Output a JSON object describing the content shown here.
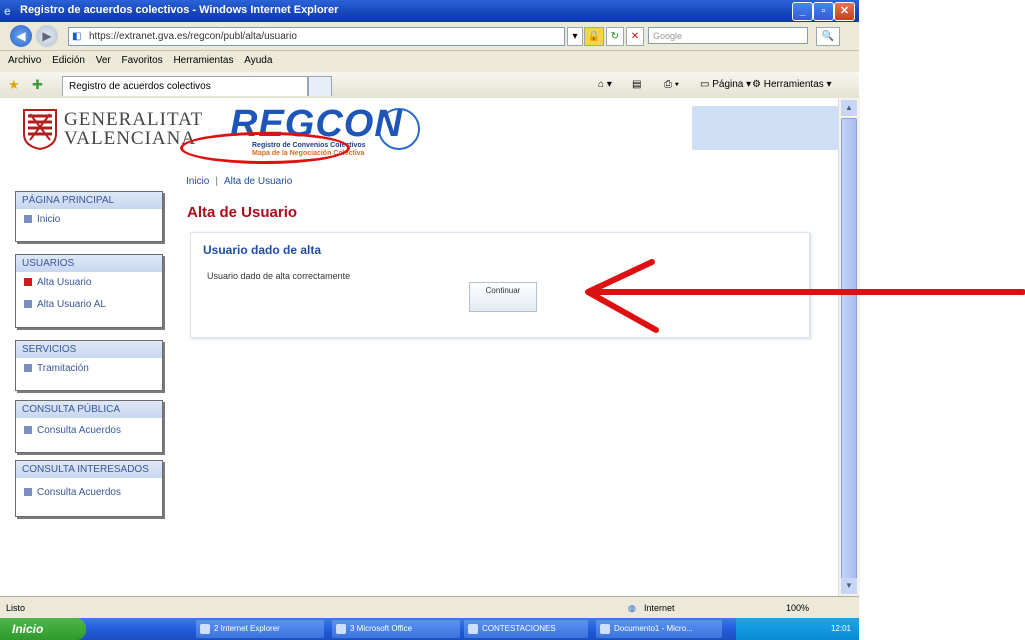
{
  "window": {
    "title": "Registro de acuerdos colectivos - Windows Internet Explorer"
  },
  "address_bar": {
    "url": "https://extranet.gva.es/regcon/publ/alta/usuario",
    "search_placeholder": "Google"
  },
  "menu": [
    "Archivo",
    "Edición",
    "Ver",
    "Favoritos",
    "Herramientas",
    "Ayuda"
  ],
  "favorites_bar": {
    "tab_title": "Registro de acuerdos colectivos",
    "page_label": "Página",
    "tools_label": "Herramientas"
  },
  "header": {
    "gv_line1": "GENERALITAT",
    "gv_line2": "VALENCIANA",
    "regcon": "REGCON",
    "regcon_sub1": "Registro de Convenios Colectivos",
    "regcon_sub2": "Mapa de la Negociación Colectiva"
  },
  "breadcrumb": {
    "home": "Inicio",
    "separator": "|",
    "current": "Alta de Usuario"
  },
  "page_title": "Alta de Usuario",
  "sidebar": [
    {
      "header": "PÁGINA PRINCIPAL",
      "items": [
        {
          "label": "Inicio",
          "active": false
        }
      ]
    },
    {
      "header": "USUARIOS",
      "items": [
        {
          "label": "Alta Usuario",
          "active": true
        },
        {
          "label": "Alta Usuario AL",
          "active": false
        }
      ]
    },
    {
      "header": "SERVICIOS",
      "items": [
        {
          "label": "Tramitación",
          "active": false
        }
      ]
    },
    {
      "header": "CONSULTA PÚBLICA",
      "items": [
        {
          "label": "Consulta Acuerdos",
          "active": false
        }
      ]
    },
    {
      "header": "CONSULTA INTERESADOS",
      "items": [
        {
          "label": "Consulta Acuerdos",
          "active": false
        }
      ]
    }
  ],
  "panel": {
    "heading": "Usuario dado de alta",
    "message": "Usuario dado de alta correctamente",
    "button_label": "Continuar"
  },
  "status_bar": {
    "left": "Listo",
    "zone": "Internet",
    "zoom": "100%"
  },
  "taskbar": {
    "start_label": "Inicio",
    "buttons": [
      "2 Internet Explorer",
      "3 Microsoft Office",
      "CONTESTACIONES",
      "Documento1 - Micro..."
    ],
    "clock": "12:01"
  },
  "colors": {
    "annotation": "#dd1111",
    "title_red": "#b00a1a",
    "link_blue": "#1f4e9c",
    "xp_blue": "#245ed8"
  }
}
